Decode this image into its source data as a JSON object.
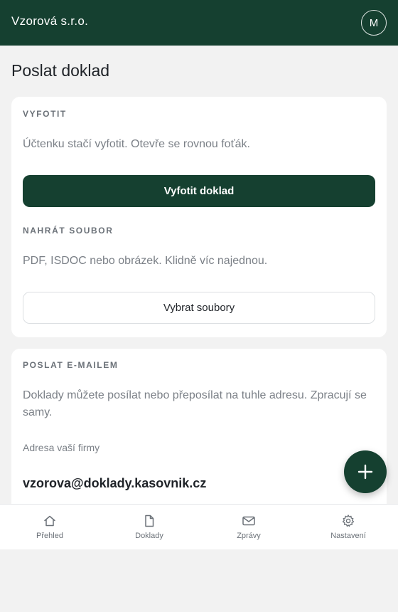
{
  "header": {
    "company": "Vzorová s.r.o.",
    "avatar_initial": "M"
  },
  "page": {
    "title": "Poslat doklad"
  },
  "photo_section": {
    "label": "VYFOTIT",
    "text": "Účtenku stačí vyfotit. Otevře se rovnou foťák.",
    "button": "Vyfotit doklad"
  },
  "upload_section": {
    "label": "NAHRÁT SOUBOR",
    "text": "PDF, ISDOC nebo obrázek. Klidně víc najednou.",
    "button": "Vybrat soubory"
  },
  "email_section": {
    "label": "POSLAT E-MAILEM",
    "text": "Doklady můžete posílat nebo přeposílat na tuhle adresu. Zpracují se samy.",
    "address_label": "Adresa vaší firmy",
    "address": "vzorova@doklady.kasovnik.cz"
  },
  "fab": {
    "icon": "plus-icon"
  },
  "nav": {
    "items": [
      {
        "label": "Přehled",
        "icon": "home-icon"
      },
      {
        "label": "Doklady",
        "icon": "document-icon"
      },
      {
        "label": "Zprávy",
        "icon": "mail-icon"
      },
      {
        "label": "Nastavení",
        "icon": "gear-icon"
      }
    ]
  },
  "colors": {
    "brand": "#154030",
    "background": "#f2f2f2",
    "muted_text": "#7b8087"
  }
}
